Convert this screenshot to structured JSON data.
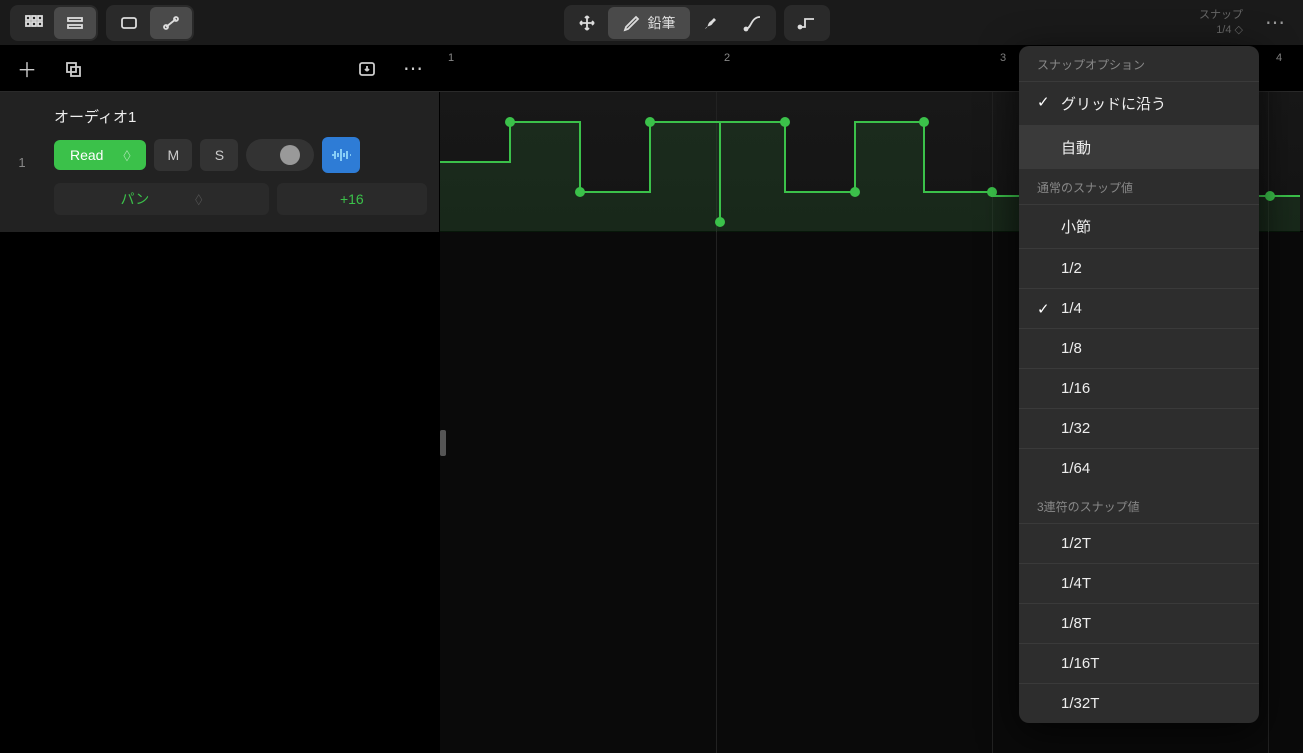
{
  "toolbar": {
    "view_mode_grid": "grid",
    "view_mode_list": "list",
    "region_tool": "region",
    "automation_tool": "automation",
    "move_tool": "move",
    "pencil_label": "鉛筆",
    "brush_tool": "brush",
    "curve_tool": "curve",
    "line_tool": "line",
    "snap_label": "スナップ",
    "snap_value": "1/4"
  },
  "subheader": {
    "add": "+",
    "copy": "⧉",
    "dl": "↓",
    "more": "⋯"
  },
  "ruler": {
    "marks": [
      "1",
      "2",
      "3",
      "4"
    ]
  },
  "track": {
    "number": "1",
    "name": "オーディオ1",
    "automation_mode": "Read",
    "mute": "M",
    "solo": "S",
    "param_label": "パン",
    "param_value": "+16"
  },
  "snap_menu": {
    "header1": "スナップオプション",
    "item_grid": "グリッドに沿う",
    "item_auto": "自動",
    "header2": "通常のスナップ値",
    "normal": [
      "小節",
      "1/2",
      "1/4",
      "1/8",
      "1/16",
      "1/32",
      "1/64"
    ],
    "header3": "3連符のスナップ値",
    "triplet": [
      "1/2T",
      "1/4T",
      "1/8T",
      "1/16T",
      "1/32T"
    ],
    "checked": [
      "グリッドに沿う",
      "1/4"
    ],
    "highlighted": "自動"
  },
  "chart_data": {
    "type": "line",
    "ylabel": "パン",
    "ylim": [
      -64,
      64
    ],
    "xlim_bars": [
      1,
      4
    ],
    "points": [
      {
        "bar": 1.0,
        "value": 0
      },
      {
        "bar": 1.25,
        "value": 64
      },
      {
        "bar": 1.5,
        "value": -32
      },
      {
        "bar": 1.75,
        "value": 64
      },
      {
        "bar": 2.0,
        "value": -64
      },
      {
        "bar": 2.0,
        "value": 64
      },
      {
        "bar": 2.25,
        "value": -32
      },
      {
        "bar": 2.5,
        "value": 64
      },
      {
        "bar": 2.75,
        "value": -32
      },
      {
        "bar": 3.0,
        "value": -40
      },
      {
        "bar": 4.0,
        "value": -40
      }
    ]
  }
}
